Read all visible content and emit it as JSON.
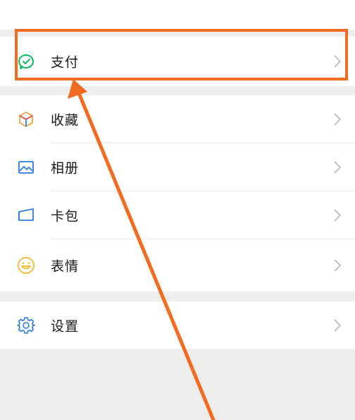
{
  "menu": {
    "pay": {
      "label": "支付",
      "icon": "wechat-pay-icon",
      "accent": "#07c160"
    },
    "favorites": {
      "label": "收藏",
      "icon": "cube-icon",
      "accent": "#f2a33a"
    },
    "album": {
      "label": "相册",
      "icon": "picture-icon",
      "accent": "#2c7be5"
    },
    "cards": {
      "label": "卡包",
      "icon": "card-wallet-icon",
      "accent": "#2c7be5"
    },
    "stickers": {
      "label": "表情",
      "icon": "smiley-icon",
      "accent": "#f5b72b"
    },
    "settings": {
      "label": "设置",
      "icon": "gear-icon",
      "accent": "#2c7be5"
    }
  },
  "annotation": {
    "color": "#f26b21"
  }
}
